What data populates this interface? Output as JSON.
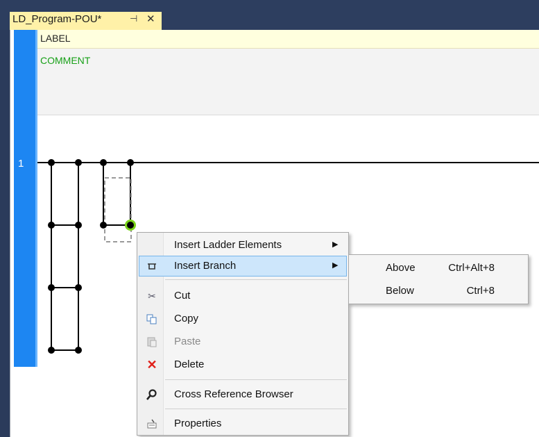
{
  "tab": {
    "title": "LD_Program-POU*",
    "pin_glyph": "⊣",
    "close_glyph": "✕"
  },
  "editor": {
    "network_number": "1",
    "label": "LABEL",
    "comment": "COMMENT"
  },
  "context_menu": {
    "items": [
      {
        "label": "Insert Ladder Elements",
        "icon": "none",
        "submenu": true
      },
      {
        "label": "Insert Branch",
        "icon": "insert-branch-icon",
        "submenu": true,
        "highlighted": true
      },
      {
        "label": "Cut",
        "icon": "scissors-icon"
      },
      {
        "label": "Copy",
        "icon": "copy-icon"
      },
      {
        "label": "Paste",
        "icon": "paste-icon",
        "disabled": true
      },
      {
        "label": "Delete",
        "icon": "delete-x-icon"
      },
      {
        "label": "Cross Reference Browser",
        "icon": "magnifier-icon"
      },
      {
        "label": "Properties",
        "icon": "properties-icon"
      }
    ]
  },
  "sub_menu": {
    "items": [
      {
        "label": "Above",
        "shortcut": "Ctrl+Alt+8"
      },
      {
        "label": "Below",
        "shortcut": "Ctrl+8"
      }
    ]
  },
  "colors": {
    "tab_bg": "#fff1a8",
    "network_bar": "#1d86f2",
    "comment_text": "#17a017",
    "highlight": "#cde6fb",
    "selected_node": "#7bd31a"
  }
}
